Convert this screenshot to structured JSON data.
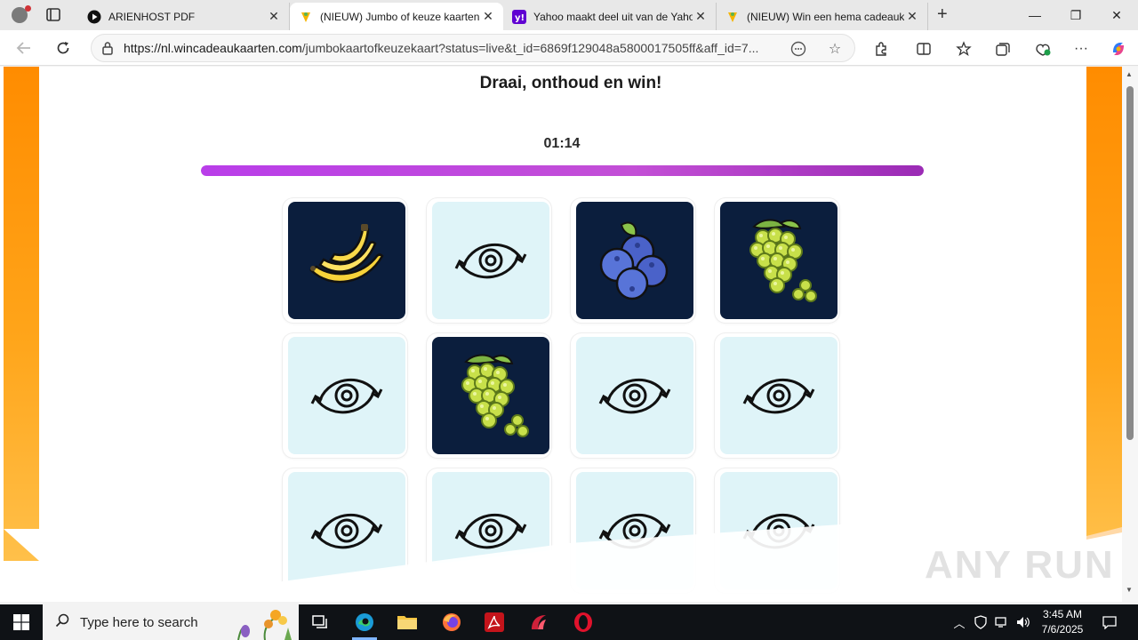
{
  "browser": {
    "tabs": [
      {
        "title": "ARIENHOST PDF",
        "favicon": "play-circle-icon",
        "active": false
      },
      {
        "title": "(NIEUW) Jumbo of keuze kaarten",
        "favicon": "wincadeau-icon",
        "active": true
      },
      {
        "title": "Yahoo maakt deel uit van de Yahoo",
        "favicon": "yahoo-icon",
        "active": false
      },
      {
        "title": "(NIEUW) Win een hema cadeaukaart",
        "favicon": "wincadeau-icon",
        "active": false
      }
    ],
    "url_host": "https://nl.wincadeaukaarten.com",
    "url_rest": "/jumbokaartofkeuzekaart?status=live&t_id=6869f129048a5800017505ff&aff_id=7..."
  },
  "page": {
    "title": "Draai, onthoud en win!",
    "timer": "01:14",
    "progress_fraction": 1.0,
    "cards": [
      {
        "state": "shown",
        "fruit": "banana"
      },
      {
        "state": "hidden",
        "fruit": ""
      },
      {
        "state": "shown",
        "fruit": "blueberries"
      },
      {
        "state": "shown",
        "fruit": "grapes"
      },
      {
        "state": "hidden",
        "fruit": ""
      },
      {
        "state": "shown",
        "fruit": "grapes"
      },
      {
        "state": "hidden",
        "fruit": ""
      },
      {
        "state": "hidden",
        "fruit": ""
      },
      {
        "state": "hidden",
        "fruit": ""
      },
      {
        "state": "hidden",
        "fruit": ""
      },
      {
        "state": "hidden",
        "fruit": ""
      },
      {
        "state": "hidden",
        "fruit": ""
      }
    ],
    "watermark": "ANY RUN",
    "colors": {
      "accent": "#c044e0",
      "card_back": "#dff4f8",
      "card_front": "#0b1e3d",
      "side_orange": "#ff8c00"
    }
  },
  "taskbar": {
    "search_placeholder": "Type here to search",
    "apps": [
      "task-view-icon",
      "edge-icon",
      "file-explorer-icon",
      "firefox-icon",
      "acrobat-icon",
      "app-red-icon",
      "opera-icon"
    ],
    "time": "3:45 AM",
    "date": "7/6/2025"
  }
}
